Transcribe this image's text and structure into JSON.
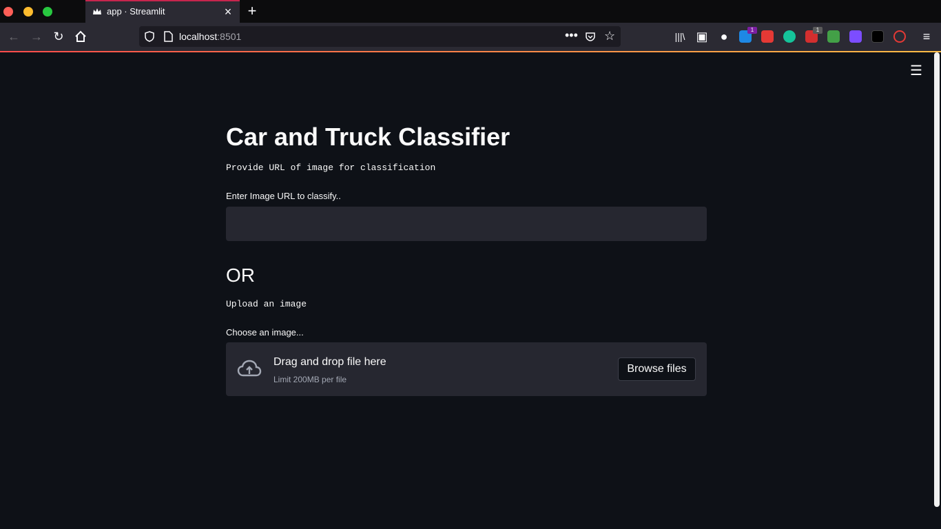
{
  "browser": {
    "tab_title": "app · Streamlit",
    "url_host": "localhost",
    "url_port": ":8501",
    "ext_badge_1": "1",
    "ext_badge_2": "1"
  },
  "app": {
    "title": "Car and Truck Classifier",
    "url_caption": "Provide URL of image for classification",
    "url_label": "Enter Image URL to classify..",
    "url_value": "",
    "or_heading": "OR",
    "upload_caption": "Upload an image",
    "upload_label": "Choose an image...",
    "dropzone_title": "Drag and drop file here",
    "dropzone_limit": "Limit 200MB per file",
    "browse_label": "Browse files"
  },
  "colors": {
    "background": "#0e1117",
    "widget": "#262730",
    "text": "#fafafa",
    "accent_start": "#ff4b4b",
    "accent_end": "#ffbd45"
  }
}
